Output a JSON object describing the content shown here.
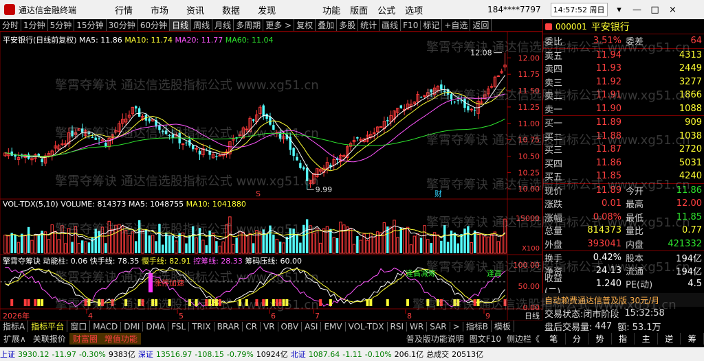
{
  "app": {
    "title": "通达信金融终端"
  },
  "menu": [
    "行情",
    "市场",
    "资讯",
    "数据",
    "发现",
    "功能",
    "版面",
    "公式",
    "选项"
  ],
  "account": "184****7797",
  "clock": "14:57:52 周日",
  "window_buttons": [
    "▾",
    "—",
    "□",
    "×"
  ],
  "toolbar": [
    "分时",
    "1分钟",
    "5分钟",
    "15分钟",
    "30分钟",
    "60分钟",
    "日线",
    "周线",
    "月线",
    "多周期",
    "更多 >",
    "复权",
    "叠加",
    "多股",
    "统计",
    "画线",
    "F10",
    "标记",
    "+自选",
    "返回"
  ],
  "toolbar_active": "日线",
  "main_header": {
    "name": "平安银行(日线前复权)",
    "ma5": "MA5: 11.86",
    "ma10": "MA10: 11.74",
    "ma20": "MA20: 11.77",
    "ma60": "MA60: 11.04"
  },
  "price_axis": [
    "12.00",
    "11.75",
    "11.50",
    "11.25",
    "11.00",
    "10.75",
    "10.50",
    "10.25",
    "10.00"
  ],
  "price_annotations": {
    "high": "12.08",
    "low": "9.99",
    "marker_s": "S",
    "marker_cai": "财"
  },
  "vol_header": {
    "name": "VOL-TDX(5,10)",
    "volume": "VOLUME: 814373",
    "ma5": "MA5: 1048755",
    "ma10": "MA10: 1041880"
  },
  "vol_axis": {
    "top": "15000",
    "unit": "X100"
  },
  "ind_header": {
    "name": "擎霄夺筹诀",
    "k1": "动能柱: 0.06",
    "k2": "快手线: 78.35",
    "k3": "慢手线: 82.91",
    "k4": "控筹线: 28.33",
    "k5": "筹码压线: 60.00"
  },
  "ind_axis": [
    "100.00",
    "50.00",
    "0.00"
  ],
  "ind_labels": [
    "涨停加速",
    "逢高减筹",
    "逢高"
  ],
  "date_axis": {
    "year": "2026年",
    "months": [
      "4",
      "5",
      "6",
      "7",
      "8",
      "9"
    ],
    "period": "日线"
  },
  "quote": {
    "code": "000001",
    "name": "平安银行",
    "ratio_l": "委比",
    "ratio": "3.51%",
    "diff_l": "委差",
    "diff": "64",
    "asks": [
      {
        "l": "卖五",
        "p": "11.94",
        "v": "4313"
      },
      {
        "l": "卖四",
        "p": "11.93",
        "v": "2449"
      },
      {
        "l": "卖三",
        "p": "11.92",
        "v": "3277"
      },
      {
        "l": "卖二",
        "p": "11.91",
        "v": "1866"
      },
      {
        "l": "卖一",
        "p": "11.90",
        "v": "1088"
      }
    ],
    "bids": [
      {
        "l": "买一",
        "p": "11.89",
        "v": "909"
      },
      {
        "l": "买二",
        "p": "11.88",
        "v": "1038"
      },
      {
        "l": "买三",
        "p": "11.87",
        "v": "2720"
      },
      {
        "l": "买四",
        "p": "11.86",
        "v": "5031"
      },
      {
        "l": "买五",
        "p": "11.85",
        "v": "4240"
      }
    ],
    "stats": [
      {
        "l1": "现价",
        "v1": "11.89",
        "c1": "red",
        "l2": "今开",
        "v2": "11.86",
        "c2": "grn"
      },
      {
        "l1": "涨跌",
        "v1": "0.01",
        "c1": "red",
        "l2": "最高",
        "v2": "12.00",
        "c2": "red"
      },
      {
        "l1": "涨幅",
        "v1": "0.08%",
        "c1": "red",
        "l2": "最低",
        "v2": "11.85",
        "c2": "grn"
      },
      {
        "l1": "总量",
        "v1": "814373",
        "c1": "yel",
        "l2": "量比",
        "v2": "0.77",
        "c2": "yel"
      },
      {
        "l1": "外盘",
        "v1": "393041",
        "c1": "red",
        "l2": "内盘",
        "v2": "421332",
        "c2": "grn"
      },
      {
        "l1": "换手",
        "v1": "0.42%",
        "c1": "wht",
        "l2": "股本",
        "v2": "194亿",
        "c2": "wht"
      },
      {
        "l1": "净资",
        "v1": "24.13",
        "c1": "wht",
        "l2": "流通",
        "v2": "194亿",
        "c2": "wht"
      },
      {
        "l1": "收益(二)",
        "v1": "1.240",
        "c1": "wht",
        "l2": "PE(动)",
        "v2": "4.5",
        "c2": "wht"
      }
    ]
  },
  "ad": "自动赖费通达信普及版 30元/月",
  "status": {
    "state_l": "交易状态:",
    "state": "闭市阶段",
    "time": "15:32:58",
    "after_l": "盘后交易量:",
    "after": "447",
    "amt_l": "额:",
    "amt": "53.1万"
  },
  "tabs1": [
    "指标A",
    "指标平台",
    "窗口",
    "MACD",
    "DMI",
    "DMA",
    "FSL",
    "TRIX",
    "BRAR",
    "CR",
    "VR",
    "OBV",
    "ASI",
    "EMV",
    "VOL-TDX",
    "RSI",
    "WR",
    "SAR",
    "> ",
    "指标B",
    "模板"
  ],
  "tabs1_active": "指标平台",
  "tabs2": [
    "扩展∧",
    "关联报价",
    "财富圈",
    "增值功能"
  ],
  "tabs2_hl": [
    "财富圈",
    "增值功能"
  ],
  "tabs2_right": [
    "普及版功能说明",
    "图文F10",
    "侧边栏《"
  ],
  "navbtns": [
    "笔",
    "分",
    "势",
    "指",
    "主",
    "逆",
    "筹"
  ],
  "ticker": [
    {
      "t": "上证",
      "c": "tk-b"
    },
    {
      "t": "3930.12",
      "c": "tk-g"
    },
    {
      "t": "-11.97",
      "c": "tk-g"
    },
    {
      "t": "-0.30%",
      "c": "tk-g"
    },
    {
      "t": "9383亿",
      "c": ""
    },
    {
      "t": "深证",
      "c": "tk-b"
    },
    {
      "t": "13516.97",
      "c": "tk-g"
    },
    {
      "t": "-108.15",
      "c": "tk-g"
    },
    {
      "t": "-0.79%",
      "c": "tk-g"
    },
    {
      "t": "10924亿",
      "c": ""
    },
    {
      "t": "北证",
      "c": "tk-b"
    },
    {
      "t": "1087.64",
      "c": "tk-g"
    },
    {
      "t": "-1.11",
      "c": "tk-g"
    },
    {
      "t": "-0.10%",
      "c": "tk-g"
    },
    {
      "t": "206.1亿",
      "c": ""
    },
    {
      "t": "总成交",
      "c": ""
    },
    {
      "t": "20513亿",
      "c": ""
    }
  ],
  "watermark": "擎霄夺筹诀 通达信选股指标公式 www.xg51.cn"
}
